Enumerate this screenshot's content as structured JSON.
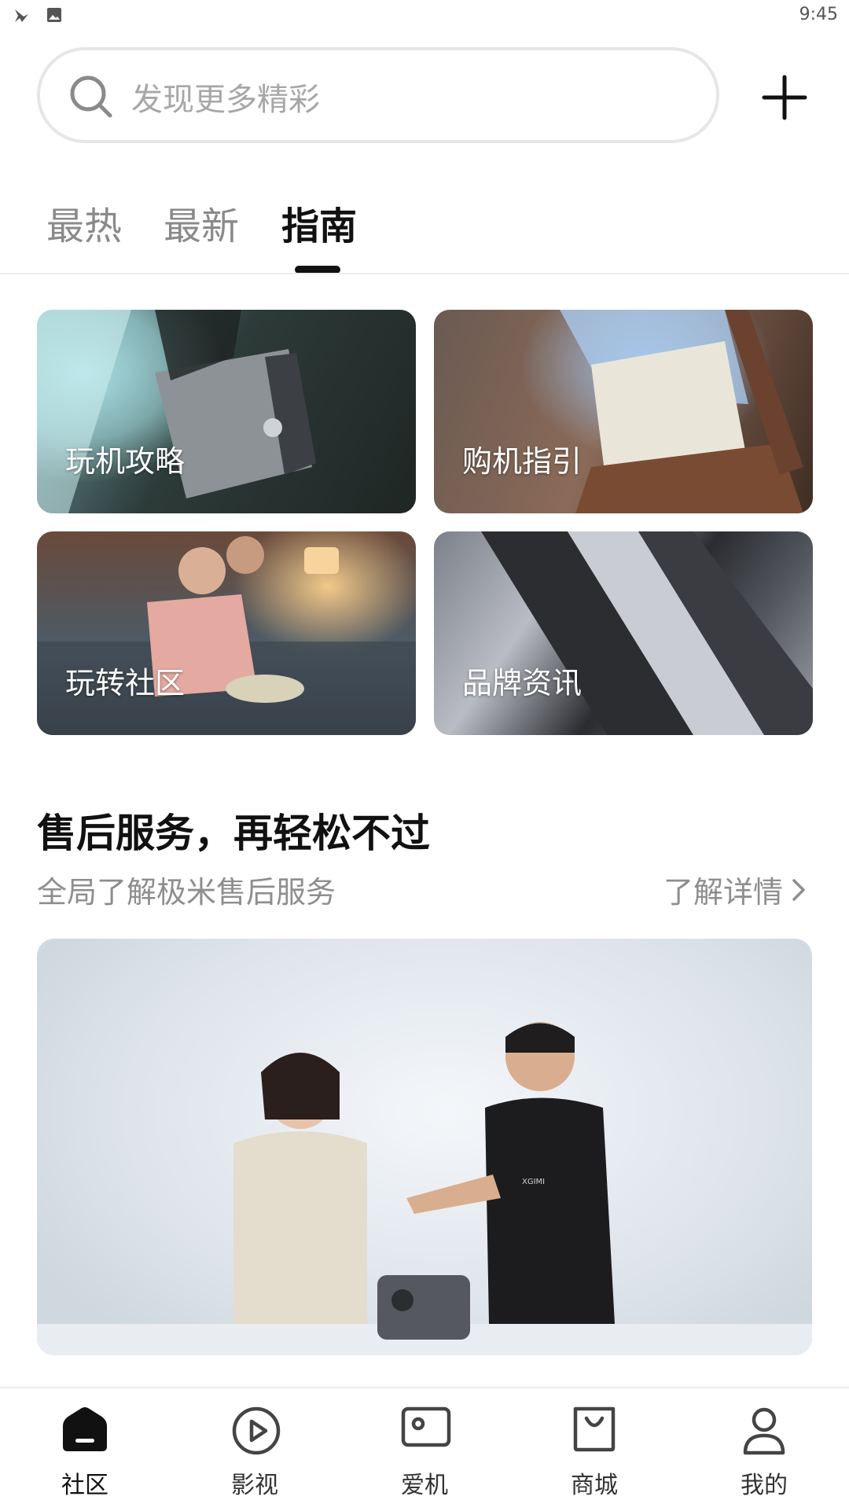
{
  "status_bar": {
    "time": "9:45",
    "icons": [
      "bird-notification-icon",
      "image-notification-icon"
    ]
  },
  "search": {
    "placeholder": "发现更多精彩",
    "icon": "search-icon"
  },
  "header_actions": {
    "add_icon": "plus-icon"
  },
  "tabs": [
    {
      "label": "最热",
      "active": false
    },
    {
      "label": "最新",
      "active": false
    },
    {
      "label": "指南",
      "active": true
    }
  ],
  "guide_cards": [
    {
      "label": "玩机攻略"
    },
    {
      "label": "购机指引"
    },
    {
      "label": "玩转社区"
    },
    {
      "label": "品牌资讯"
    }
  ],
  "section": {
    "title": "售后服务，再轻松不过",
    "subtitle": "全局了解极米售后服务",
    "more_label": "了解详情",
    "banner_brand": "XGIMI"
  },
  "bottom_nav": [
    {
      "label": "社区",
      "icon": "home-icon",
      "active": true
    },
    {
      "label": "影视",
      "icon": "play-circle-icon",
      "active": false
    },
    {
      "label": "爱机",
      "icon": "device-icon",
      "active": false
    },
    {
      "label": "商城",
      "icon": "shopping-bag-icon",
      "active": false
    },
    {
      "label": "我的",
      "icon": "user-icon",
      "active": false
    }
  ],
  "colors": {
    "text_primary": "#111111",
    "text_secondary": "#8e8e8e",
    "tab_inactive": "#8a8a8a",
    "search_border": "#e6e6e6"
  }
}
